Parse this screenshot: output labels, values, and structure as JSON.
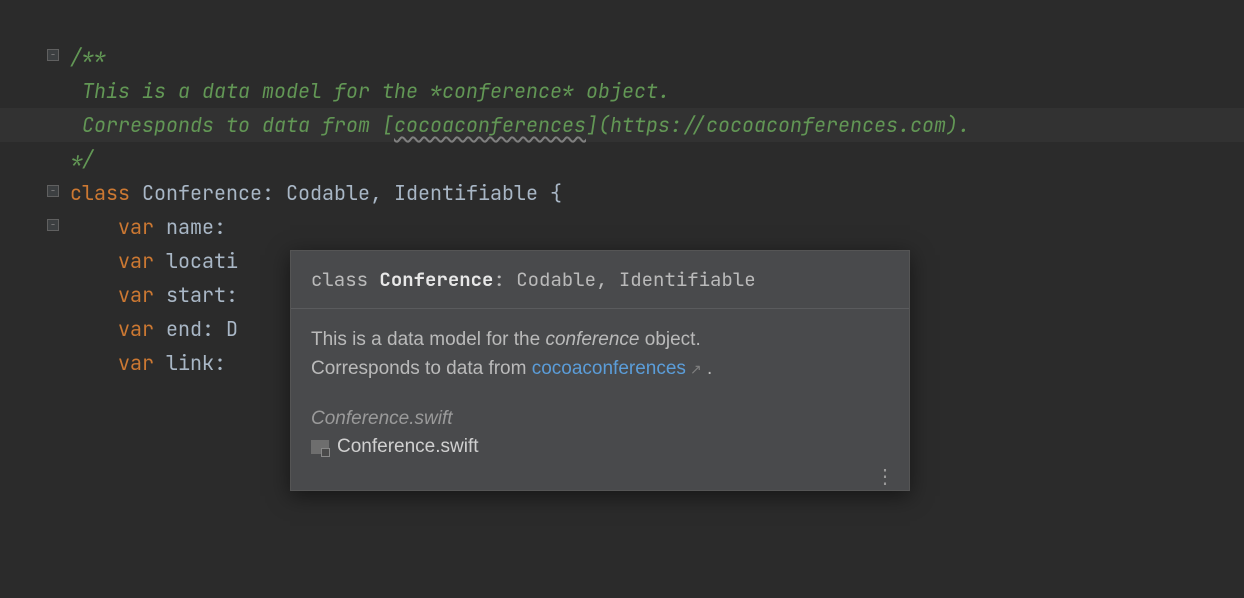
{
  "code": {
    "doc_open": "/**",
    "doc_line1": " This is a data model for the *conference* object.",
    "doc_line2_pre": " Corresponds to data from [",
    "doc_link_text": "cocoaconferences",
    "doc_line2_mid": "](",
    "doc_url": "https://cocoaconferences.com",
    "doc_line2_post": ").",
    "doc_close": "*/",
    "class_kw": "class",
    "class_name": "Conference",
    "colon": ":",
    "proto1": "Codable",
    "comma": ",",
    "proto2": "Identifiable",
    "brace": "{",
    "var_kw": "var",
    "var_name_1": "name",
    "var_name_2": "locati",
    "var_name_3": "start",
    "var_name_4": "end",
    "var_type_4": "D",
    "var_name_5": "link"
  },
  "popup": {
    "sig_kw": "class",
    "sig_name": "Conference",
    "sig_rest": ": Codable, Identifiable",
    "body_line1_pre": "This is a data model for the ",
    "body_line1_em": "conference",
    "body_line1_post": " object.",
    "body_line2_pre": "Corresponds to data from ",
    "body_link": "cocoaconferences",
    "body_line2_post": " .",
    "file_title": "Conference.swift",
    "file_name": "Conference.swift"
  }
}
